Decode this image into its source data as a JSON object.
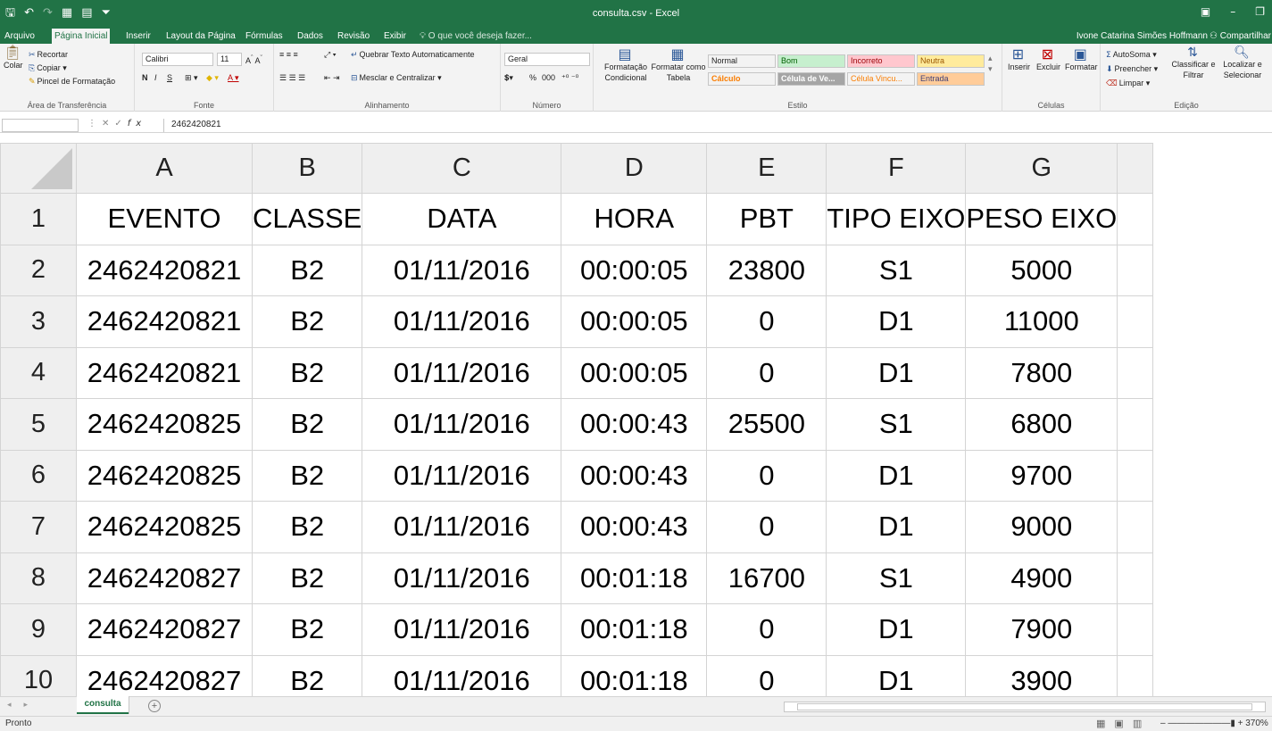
{
  "window": {
    "title": "consulta.csv - Excel",
    "qat_icons": [
      "save-icon",
      "undo-icon",
      "redo-icon",
      "form-icon",
      "table-icon",
      "customize-icon"
    ],
    "controls": [
      "ribbon-display-icon",
      "minimize-icon",
      "restore-icon"
    ]
  },
  "ribbon_tabs": {
    "items": [
      {
        "label": "Arquivo"
      },
      {
        "label": "Página Inicial"
      },
      {
        "label": "Inserir"
      },
      {
        "label": "Layout da Página"
      },
      {
        "label": "Fórmulas"
      },
      {
        "label": "Dados"
      },
      {
        "label": "Revisão"
      },
      {
        "label": "Exibir"
      }
    ],
    "active": "Página Inicial",
    "tell_me": "O que você deseja fazer...",
    "user": "Ivone Catarina Simões Hoffmann",
    "share": "Compartilhar"
  },
  "clipboard": {
    "paste": "Colar",
    "cut": "Recortar",
    "copy": "Copiar",
    "format_painter": "Pincel de Formatação",
    "label": "Área de Transferência"
  },
  "font": {
    "name": "Calibri",
    "size": "11",
    "bold": "N",
    "italic": "I",
    "underline": "S",
    "label": "Fonte"
  },
  "alignment": {
    "wrap_text": "Quebrar Texto Automaticamente",
    "merge_center": "Mesclar e Centralizar",
    "label": "Alinhamento"
  },
  "number": {
    "format": "Geral",
    "percent": "%",
    "thousands": "000",
    "label": "Número"
  },
  "styles": {
    "conditional": "Formatação Condicional",
    "format_table": "Formatar como Tabela",
    "cells": [
      {
        "label": "Normal",
        "bg": "#ffffff",
        "fg": "#000000"
      },
      {
        "label": "Bom",
        "bg": "#c6efce",
        "fg": "#006100"
      },
      {
        "label": "Incorreto",
        "bg": "#ffc7ce",
        "fg": "#9c0006"
      },
      {
        "label": "Neutra",
        "bg": "#ffeb9c",
        "fg": "#9c5700"
      },
      {
        "label": "Cálculo",
        "bg": "#f2f2f2",
        "fg": "#fa7d00"
      },
      {
        "label": "Célula de Ve...",
        "bg": "#a5a5a5",
        "fg": "#ffffff"
      },
      {
        "label": "Célula Vincu...",
        "bg": "#ffffff",
        "fg": "#fa7d00"
      },
      {
        "label": "Entrada",
        "bg": "#ffcc99",
        "fg": "#3f3f76"
      }
    ],
    "label": "Estilo"
  },
  "cells_group": {
    "insert": "Inserir",
    "delete": "Excluir",
    "format": "Formatar",
    "label": "Células"
  },
  "editing": {
    "autosum": "AutoSoma",
    "fill": "Preencher",
    "clear": "Limpar",
    "sort_filter": "Classificar e Filtrar",
    "find_select": "Localizar e Selecionar",
    "label": "Edição"
  },
  "formula_bar": {
    "name_box": "",
    "value": "2462420821"
  },
  "sheet": {
    "columns": [
      "A",
      "B",
      "C",
      "D",
      "E",
      "F",
      "G"
    ],
    "rows": [
      {
        "n": "1",
        "cells": [
          "EVENTO",
          "CLASSE",
          "DATA",
          "HORA",
          "PBT",
          "TIPO EIXO",
          "PESO EIXO"
        ]
      },
      {
        "n": "2",
        "cells": [
          "2462420821",
          "B2",
          "01/11/2016",
          "00:00:05",
          "23800",
          "S1",
          "5000"
        ]
      },
      {
        "n": "3",
        "cells": [
          "2462420821",
          "B2",
          "01/11/2016",
          "00:00:05",
          "0",
          "D1",
          "11000"
        ]
      },
      {
        "n": "4",
        "cells": [
          "2462420821",
          "B2",
          "01/11/2016",
          "00:00:05",
          "0",
          "D1",
          "7800"
        ]
      },
      {
        "n": "5",
        "cells": [
          "2462420825",
          "B2",
          "01/11/2016",
          "00:00:43",
          "25500",
          "S1",
          "6800"
        ]
      },
      {
        "n": "6",
        "cells": [
          "2462420825",
          "B2",
          "01/11/2016",
          "00:00:43",
          "0",
          "D1",
          "9700"
        ]
      },
      {
        "n": "7",
        "cells": [
          "2462420825",
          "B2",
          "01/11/2016",
          "00:00:43",
          "0",
          "D1",
          "9000"
        ]
      },
      {
        "n": "8",
        "cells": [
          "2462420827",
          "B2",
          "01/11/2016",
          "00:01:18",
          "16700",
          "S1",
          "4900"
        ]
      },
      {
        "n": "9",
        "cells": [
          "2462420827",
          "B2",
          "01/11/2016",
          "00:01:18",
          "0",
          "D1",
          "7900"
        ]
      },
      {
        "n": "10",
        "cells": [
          "2462420827",
          "B2",
          "01/11/2016",
          "00:01:18",
          "0",
          "D1",
          "3900"
        ]
      }
    ]
  },
  "sheet_tabs": {
    "active": "consulta",
    "add": "+"
  },
  "status": {
    "text": "Pronto",
    "zoom": "370%"
  }
}
